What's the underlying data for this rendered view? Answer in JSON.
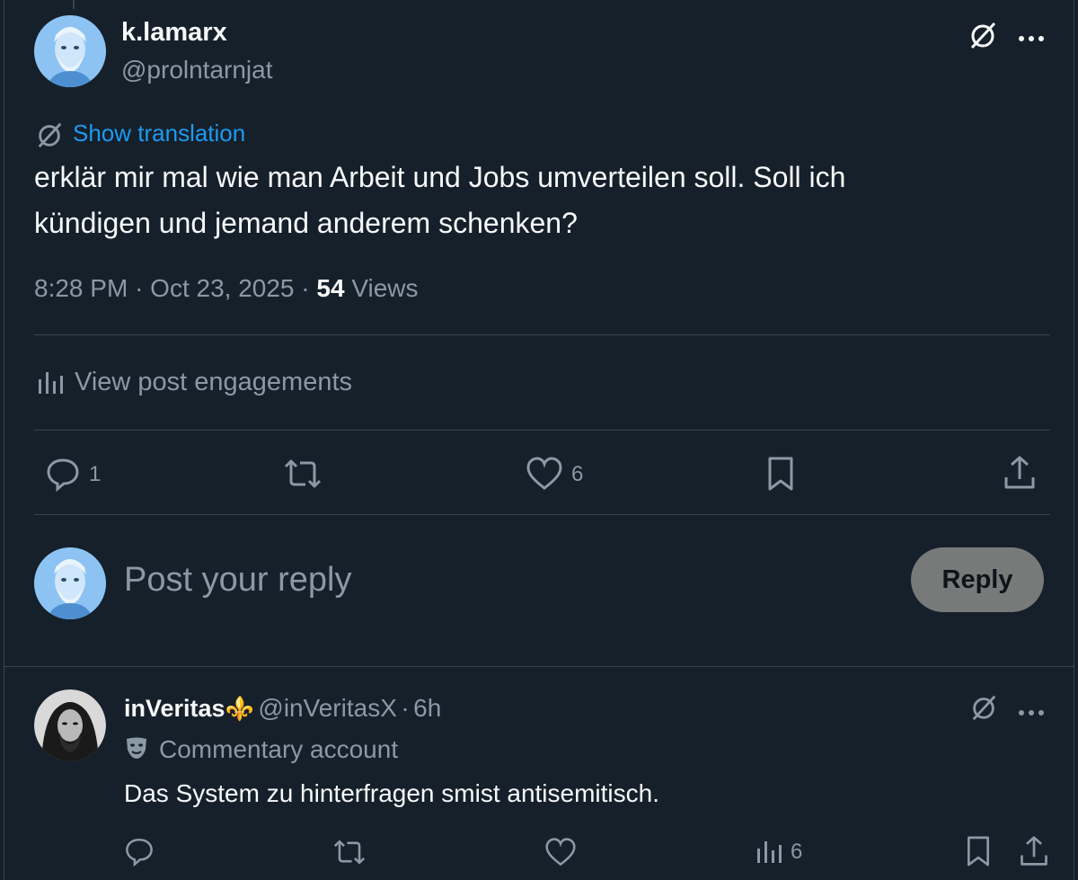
{
  "post": {
    "author_name": "k.lamarx",
    "author_handle": "@prolntarnjat",
    "translation_link": "Show translation",
    "text_line1": "erklär mir mal wie man Arbeit und Jobs umverteilen soll. Soll ich",
    "text_line2": "kündigen und jemand anderem schenken?",
    "time": "8:28 PM",
    "date": "Oct 23, 2025",
    "views_count": "54",
    "views_label": "Views",
    "sep": "·",
    "engagements_label": "View post engagements",
    "reply_count": "1",
    "like_count": "6"
  },
  "composer": {
    "placeholder": "Post your reply",
    "reply_button": "Reply"
  },
  "reply": {
    "author_name": "inVeritas",
    "author_emoji": "⚜️",
    "author_handle": "@inVeritasX",
    "time_ago": "6h",
    "sep": "·",
    "badge_label": "Commentary account",
    "text": "Das System zu hinterfragen smist antisemitisch.",
    "views_count": "6"
  },
  "icons": {
    "grok": "grok-icon",
    "more": "more-icon",
    "reply": "reply-icon",
    "repost": "repost-icon",
    "like": "like-icon",
    "bookmark": "bookmark-icon",
    "share": "share-icon",
    "analytics": "analytics-icon"
  },
  "colors": {
    "background": "#15202b",
    "accent": "#1d9bf0",
    "muted": "#8b98a5",
    "divider": "#38444d"
  }
}
